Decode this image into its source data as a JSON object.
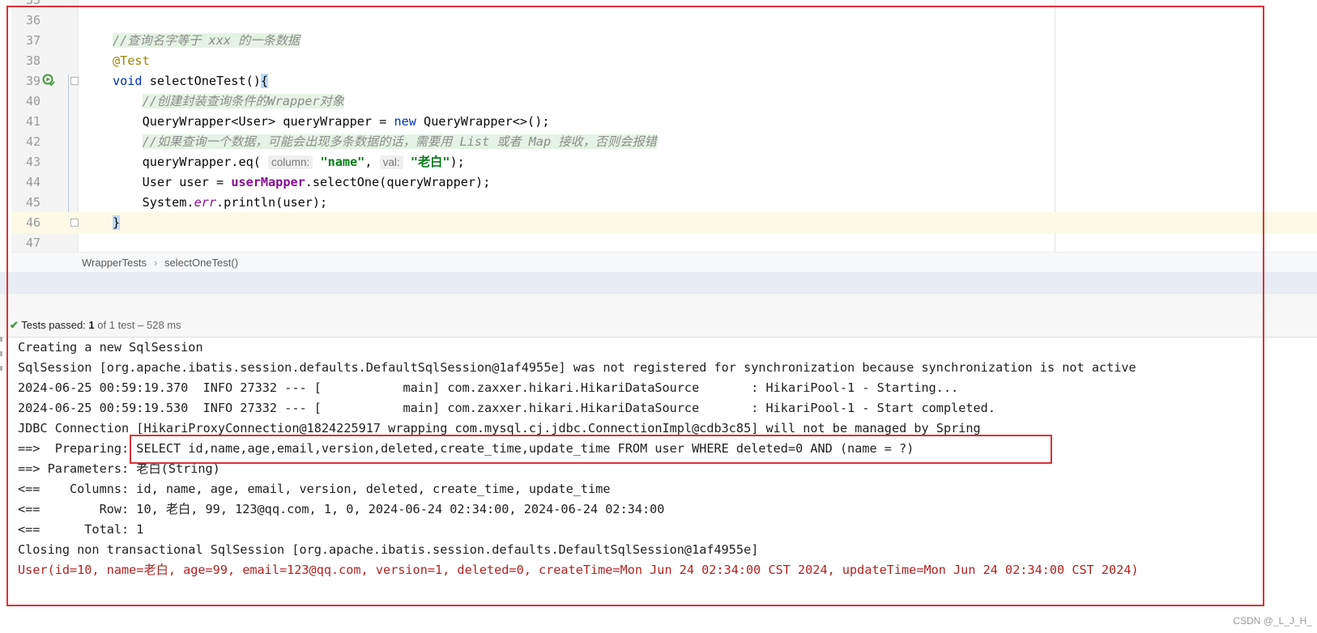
{
  "editor": {
    "partial_top_line": "35",
    "lines": [
      {
        "num": "36",
        "parts": []
      },
      {
        "num": "37",
        "parts": [
          {
            "cls": "comment",
            "text": "//查询名字等于 xxx 的一条数据"
          }
        ]
      },
      {
        "num": "38",
        "parts": [
          {
            "cls": "anno",
            "text": "@Test"
          }
        ]
      },
      {
        "num": "39",
        "parts": [
          {
            "cls": "kw",
            "text": "void"
          },
          {
            "cls": "",
            "text": " selectOneTest()"
          },
          {
            "cls": "brace-hl",
            "text": "{"
          }
        ]
      },
      {
        "num": "40",
        "parts": [
          {
            "cls": "",
            "text": "    "
          },
          {
            "cls": "comment",
            "text": "//创建封装查询条件的Wrapper对象"
          }
        ]
      },
      {
        "num": "41",
        "parts": [
          {
            "cls": "",
            "text": "    QueryWrapper<User> queryWrapper = "
          },
          {
            "cls": "kw",
            "text": "new"
          },
          {
            "cls": "",
            "text": " QueryWrapper<>();"
          }
        ]
      },
      {
        "num": "42",
        "parts": [
          {
            "cls": "",
            "text": "    "
          },
          {
            "cls": "comment",
            "text": "//如果查询一个数据，可能会出现多条数据的话，需要用 List 或者 Map 接收，否则会报错"
          }
        ]
      },
      {
        "num": "43",
        "parts": [
          {
            "cls": "",
            "text": "    queryWrapper.eq( "
          },
          {
            "cls": "hint",
            "text": "column:"
          },
          {
            "cls": "",
            "text": " "
          },
          {
            "cls": "str",
            "text": "\"name\""
          },
          {
            "cls": "",
            "text": ", "
          },
          {
            "cls": "hint",
            "text": "val:"
          },
          {
            "cls": "",
            "text": " "
          },
          {
            "cls": "str",
            "text": "\"老白\""
          },
          {
            "cls": "",
            "text": ");"
          }
        ]
      },
      {
        "num": "44",
        "parts": [
          {
            "cls": "",
            "text": "    User user = "
          },
          {
            "cls": "field",
            "text": "userMapper"
          },
          {
            "cls": "",
            "text": ".selectOne(queryWrapper);"
          }
        ]
      },
      {
        "num": "45",
        "parts": [
          {
            "cls": "",
            "text": "    System."
          },
          {
            "cls": "static-field",
            "text": "err"
          },
          {
            "cls": "",
            "text": ".println(user);"
          }
        ]
      },
      {
        "num": "46",
        "parts": [
          {
            "cls": "brace-hl",
            "text": "}"
          }
        ]
      },
      {
        "num": "47",
        "parts": []
      }
    ]
  },
  "breadcrumb": {
    "items": [
      "WrapperTests",
      "selectOneTest()"
    ],
    "separator": "›"
  },
  "test_status": {
    "check": "✔",
    "label": "Tests passed:",
    "count": "1",
    "rest": "of 1 test – 528 ms"
  },
  "console": {
    "lines": [
      {
        "text": "Creating a new SqlSession",
        "err": false
      },
      {
        "text": "SqlSession [org.apache.ibatis.session.defaults.DefaultSqlSession@1af4955e] was not registered for synchronization because synchronization is not active",
        "err": false
      },
      {
        "text": "2024-06-25 00:59:19.370  INFO 27332 --- [           main] com.zaxxer.hikari.HikariDataSource       : HikariPool-1 - Starting...",
        "err": false
      },
      {
        "text": "2024-06-25 00:59:19.530  INFO 27332 --- [           main] com.zaxxer.hikari.HikariDataSource       : HikariPool-1 - Start completed.",
        "err": false
      },
      {
        "text": "JDBC Connection [HikariProxyConnection@1824225917 wrapping com.mysql.cj.jdbc.ConnectionImpl@cdb3c85] will not be managed by Spring",
        "err": false
      },
      {
        "text": "==>  Preparing: SELECT id,name,age,email,version,deleted,create_time,update_time FROM user WHERE deleted=0 AND (name = ?)",
        "err": false
      },
      {
        "text": "==> Parameters: 老白(String)",
        "err": false
      },
      {
        "text": "<==    Columns: id, name, age, email, version, deleted, create_time, update_time",
        "err": false
      },
      {
        "text": "<==        Row: 10, 老白, 99, 123@qq.com, 1, 0, 2024-06-24 02:34:00, 2024-06-24 02:34:00",
        "err": false
      },
      {
        "text": "<==      Total: 1",
        "err": false
      },
      {
        "text": "Closing non transactional SqlSession [org.apache.ibatis.session.defaults.DefaultSqlSession@1af4955e]",
        "err": false
      },
      {
        "text": "User(id=10, name=老白, age=99, email=123@qq.com, version=1, deleted=0, createTime=Mon Jun 24 02:34:00 CST 2024, updateTime=Mon Jun 24 02:34:00 CST 2024)",
        "err": true
      }
    ]
  },
  "watermark": "CSDN @_L_J_H_",
  "icons": {
    "run": "run-test-icon",
    "fold": "fold-marker-icon",
    "check": "check-icon"
  },
  "colors": {
    "annotation_red": "#d9323a",
    "keyword": "#0033b3",
    "string": "#067d17",
    "error_output": "#b22222"
  }
}
